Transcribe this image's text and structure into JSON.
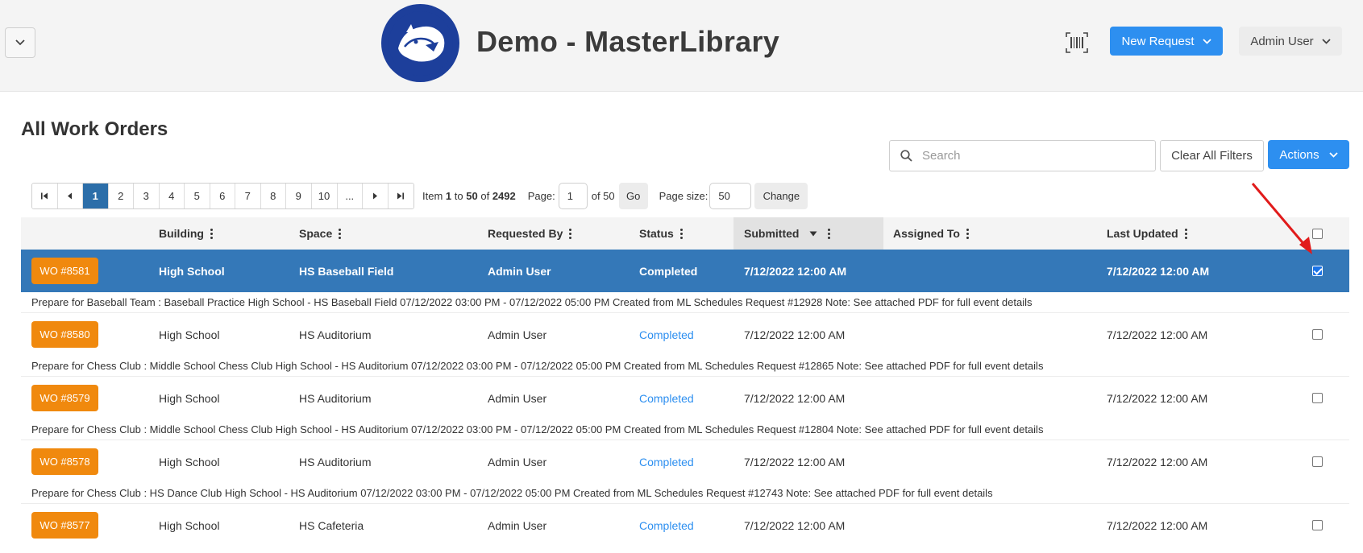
{
  "header": {
    "app_title": "Demo - MasterLibrary",
    "new_request_label": "New Request",
    "user_label": "Admin User",
    "brand_color": "#2d8ff0"
  },
  "page": {
    "title": "All Work Orders"
  },
  "toolbar": {
    "search_placeholder": "Search",
    "clear_filters_label": "Clear All Filters",
    "actions_label": "Actions"
  },
  "pager": {
    "pages": [
      "1",
      "2",
      "3",
      "4",
      "5",
      "6",
      "7",
      "8",
      "9",
      "10",
      "..."
    ],
    "active_page": "1",
    "info_prefix": "Item",
    "info_from": "1",
    "info_to_word": "to",
    "info_to": "50",
    "info_of_word": "of",
    "info_total": "2492",
    "page_label": "Page:",
    "page_value": "1",
    "page_of": "of 50",
    "go_label": "Go",
    "page_size_label": "Page size:",
    "page_size_value": "50",
    "change_label": "Change"
  },
  "table": {
    "columns": {
      "building": "Building",
      "space": "Space",
      "requested_by": "Requested By",
      "status": "Status",
      "submitted": "Submitted",
      "assigned_to": "Assigned To",
      "last_updated": "Last Updated"
    },
    "rows": [
      {
        "wo": "WO #8581",
        "building": "High School",
        "space": "HS Baseball Field",
        "requested_by": "Admin User",
        "status": "Completed",
        "submitted": "7/12/2022 12:00 AM",
        "assigned_to": "",
        "last_updated": "7/12/2022 12:00 AM",
        "selected": true,
        "description": "Prepare for Baseball Team : Baseball Practice High School - HS Baseball Field 07/12/2022 03:00 PM - 07/12/2022 05:00 PM Created from ML Schedules Request #12928 Note: See attached PDF for full event details"
      },
      {
        "wo": "WO #8580",
        "building": "High School",
        "space": "HS Auditorium",
        "requested_by": "Admin User",
        "status": "Completed",
        "submitted": "7/12/2022 12:00 AM",
        "assigned_to": "",
        "last_updated": "7/12/2022 12:00 AM",
        "selected": false,
        "description": "Prepare for Chess Club : Middle School Chess Club High School - HS Auditorium 07/12/2022 03:00 PM - 07/12/2022 05:00 PM Created from ML Schedules Request #12865 Note: See attached PDF for full event details"
      },
      {
        "wo": "WO #8579",
        "building": "High School",
        "space": "HS Auditorium",
        "requested_by": "Admin User",
        "status": "Completed",
        "submitted": "7/12/2022 12:00 AM",
        "assigned_to": "",
        "last_updated": "7/12/2022 12:00 AM",
        "selected": false,
        "description": "Prepare for Chess Club : Middle School Chess Club High School - HS Auditorium 07/12/2022 03:00 PM - 07/12/2022 05:00 PM Created from ML Schedules Request #12804 Note: See attached PDF for full event details"
      },
      {
        "wo": "WO #8578",
        "building": "High School",
        "space": "HS Auditorium",
        "requested_by": "Admin User",
        "status": "Completed",
        "submitted": "7/12/2022 12:00 AM",
        "assigned_to": "",
        "last_updated": "7/12/2022 12:00 AM",
        "selected": false,
        "description": "Prepare for Chess Club : HS Dance Club High School - HS Auditorium 07/12/2022 03:00 PM - 07/12/2022 05:00 PM Created from ML Schedules Request #12743 Note: See attached PDF for full event details"
      },
      {
        "wo": "WO #8577",
        "building": "High School",
        "space": "HS Cafeteria",
        "requested_by": "Admin User",
        "status": "Completed",
        "submitted": "7/12/2022 12:00 AM",
        "assigned_to": "",
        "last_updated": "7/12/2022 12:00 AM",
        "selected": false,
        "description": ""
      }
    ]
  },
  "icons": {
    "collapse": "chevron-down-icon",
    "logo": "panther-logo",
    "barcode": "barcode-icon",
    "search": "search-icon"
  }
}
